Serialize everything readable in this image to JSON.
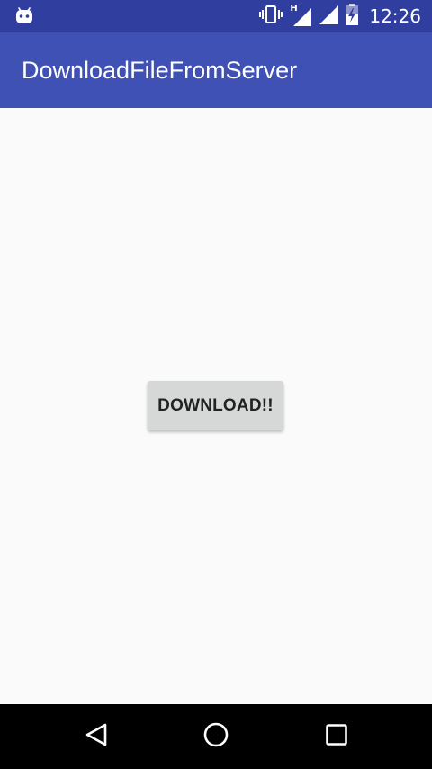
{
  "status_bar": {
    "time": "12:26",
    "icons": [
      "android-debug-icon",
      "vibrate-icon",
      "network-h-signal-icon",
      "signal-icon",
      "battery-charging-icon"
    ],
    "network_type": "H"
  },
  "app_bar": {
    "title": "DownloadFileFromServer"
  },
  "main": {
    "download_button_label": "DOWNLOAD!!"
  },
  "nav_bar": {
    "icons": [
      "back-icon",
      "home-icon",
      "recents-icon"
    ]
  },
  "colors": {
    "status_bar": "#303f9f",
    "app_bar": "#3f51b5",
    "background": "#fafafa",
    "button": "#d6d7d7",
    "nav_bar": "#000000"
  }
}
